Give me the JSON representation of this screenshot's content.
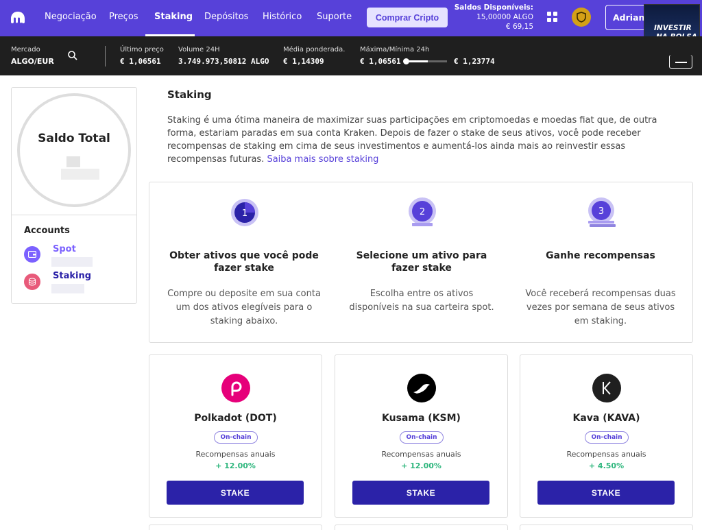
{
  "nav": {
    "items": [
      "Negociação",
      "Preços",
      "Staking",
      "Depósitos",
      "Histórico",
      "Suporte"
    ],
    "active": "Staking",
    "buy_label": "Comprar Cripto",
    "balances_title": "Saldos Disponíveis:",
    "balance_algo": "15,00000 ALGO",
    "balance_eur": "€ 69,15",
    "user_label": "Adriano"
  },
  "promo": {
    "line1": "INVESTIR",
    "line2": "NA BOLSA"
  },
  "ticker": {
    "market_label": "Mercado",
    "market_value": "ALGO/EUR",
    "last_price_label": "Último preço",
    "last_price": "€ 1,06561",
    "volume_label": "Volume 24H",
    "volume": "3.749.973,50812 ALGO",
    "vwap_label": "Média ponderada.",
    "vwap": "€ 1,14309",
    "range_label": "Máxima/Mínima 24h",
    "range_low": "€ 1,06561",
    "range_high": "€ 1,23774"
  },
  "sidebar": {
    "total_title": "Saldo Total",
    "accounts_title": "Accounts",
    "accounts": [
      {
        "label": "Spot",
        "icon": "wallet-icon",
        "color": "#7b61ff"
      },
      {
        "label": "Staking",
        "icon": "coins-stack-icon",
        "color": "#e85a7a"
      }
    ]
  },
  "main": {
    "title": "Staking",
    "intro": "Staking é uma ótima maneira de maximizar suas participações em criptomoedas e moedas fiat que, de outra forma, estariam paradas em sua conta Kraken. Depois de fazer o stake de seus ativos, você pode receber recompensas de staking em cima de seus investimentos e aumentá-los ainda mais ao reinvestir essas recompensas futuras.",
    "intro_link": "Saiba mais sobre staking"
  },
  "steps": [
    {
      "number": "1",
      "title": "Obter ativos que você pode fazer stake",
      "desc": "Compre ou deposite em sua conta um dos ativos elegíveis para o staking abaixo."
    },
    {
      "number": "2",
      "title": "Selecione um ativo para fazer stake",
      "desc": "Escolha entre os ativos disponíveis na sua carteira spot."
    },
    {
      "number": "3",
      "title": "Ganhe recompensas",
      "desc": "Você receberá recompensas duas vezes por semana de seus ativos em staking."
    }
  ],
  "assets": [
    {
      "name": "Polkadot (DOT)",
      "chip": "On-chain",
      "reward_label": "Recompensas anuais",
      "reward": "+ 12.00%",
      "button": "STAKE",
      "logo_color": "#e6007a",
      "icon": "polkadot-icon"
    },
    {
      "name": "Kusama (KSM)",
      "chip": "On-chain",
      "reward_label": "Recompensas anuais",
      "reward": "+ 12.00%",
      "button": "STAKE",
      "logo_color": "#000000",
      "icon": "kusama-bird-icon"
    },
    {
      "name": "Kava (KAVA)",
      "chip": "On-chain",
      "reward_label": "Recompensas anuais",
      "reward": "+ 4.50%",
      "button": "STAKE",
      "logo_color": "#1f1f1f",
      "icon": "kava-k-icon"
    }
  ],
  "colors": {
    "brand": "#5741d9",
    "stake_button": "#2b22a8",
    "positive": "#2eb67d"
  }
}
